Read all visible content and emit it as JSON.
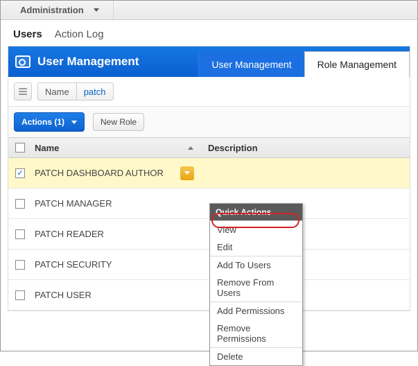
{
  "topnav": {
    "label": "Administration"
  },
  "subnav": {
    "users": "Users",
    "actionlog": "Action Log",
    "active": "users"
  },
  "panel": {
    "title": "User Management",
    "tabs": {
      "usermgmt": "User Management",
      "rolemgmt": "Role Management",
      "active": "rolemgmt"
    }
  },
  "filter": {
    "field_label": "Name",
    "value": "patch"
  },
  "actions": {
    "primary_label": "Actions (1)",
    "newrole_label": "New Role"
  },
  "grid": {
    "col_name": "Name",
    "col_desc": "Description",
    "rows": [
      {
        "name": "PATCH DASHBOARD AUTHOR",
        "desc": "",
        "checked": true
      },
      {
        "name": "PATCH MANAGER",
        "desc": "",
        "checked": false
      },
      {
        "name": "PATCH READER",
        "desc": "",
        "checked": false
      },
      {
        "name": "PATCH SECURITY",
        "desc": "",
        "checked": false
      },
      {
        "name": "PATCH USER",
        "desc": "",
        "checked": false
      }
    ]
  },
  "quickmenu": {
    "title": "Quick Actions",
    "view": "View",
    "edit": "Edit",
    "add_to_users": "Add To Users",
    "remove_from_users": "Remove From Users",
    "add_permissions": "Add Permissions",
    "remove_permissions": "Remove Permissions",
    "delete": "Delete"
  }
}
